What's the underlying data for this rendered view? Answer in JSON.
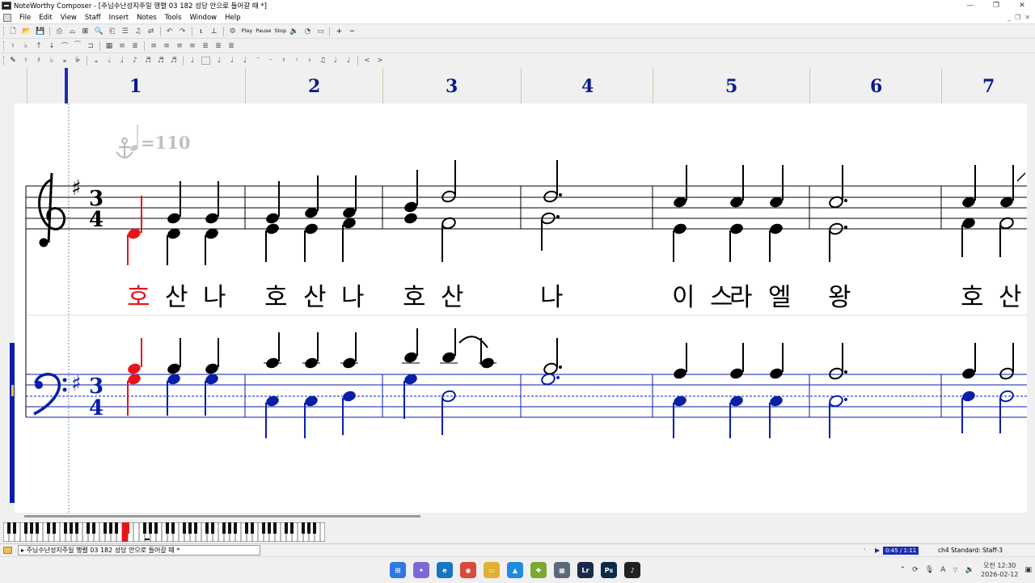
{
  "window": {
    "title": "NoteWorthy Composer - [주님수난성지주일 행렬 03 182 성당 안으로 들어갈 때 *]",
    "buttons": [
      "—",
      "❐",
      "✕"
    ]
  },
  "menu": [
    "File",
    "Edit",
    "View",
    "Staff",
    "Insert",
    "Notes",
    "Tools",
    "Window",
    "Help"
  ],
  "mdi_buttons": [
    "_",
    "❐",
    "✕"
  ],
  "toolbar1": {
    "play_label": "Play",
    "pause_label": "Pause",
    "stop_label": "Stop"
  },
  "measure_numbers": [
    "1",
    "2",
    "3",
    "4",
    "5",
    "6",
    "7"
  ],
  "score": {
    "tempo_marking": "=110",
    "time_signature_top": "3",
    "time_signature_bottom": "4",
    "key_signature": "G major (1 sharp)",
    "lyrics": [
      "호",
      "산",
      "나",
      "호",
      "산",
      "나",
      "호",
      "산",
      "나",
      "이",
      "스",
      "라",
      "엘",
      "왕",
      "호",
      "산"
    ],
    "lyric_highlight_index": 0,
    "highlight_color": "#e8141c",
    "bass_staff_color": "#0a1ea8"
  },
  "status": {
    "file_label": "주님수난성지주일 행렬 03 182 성당 안으로 들어갈 때 *",
    "dot": "·",
    "time": "0:45 / 1:11",
    "staff_info": "ch4 Standard: Staff-3"
  },
  "clock": {
    "time": "오전 12:30",
    "date": "2026-02-12"
  }
}
